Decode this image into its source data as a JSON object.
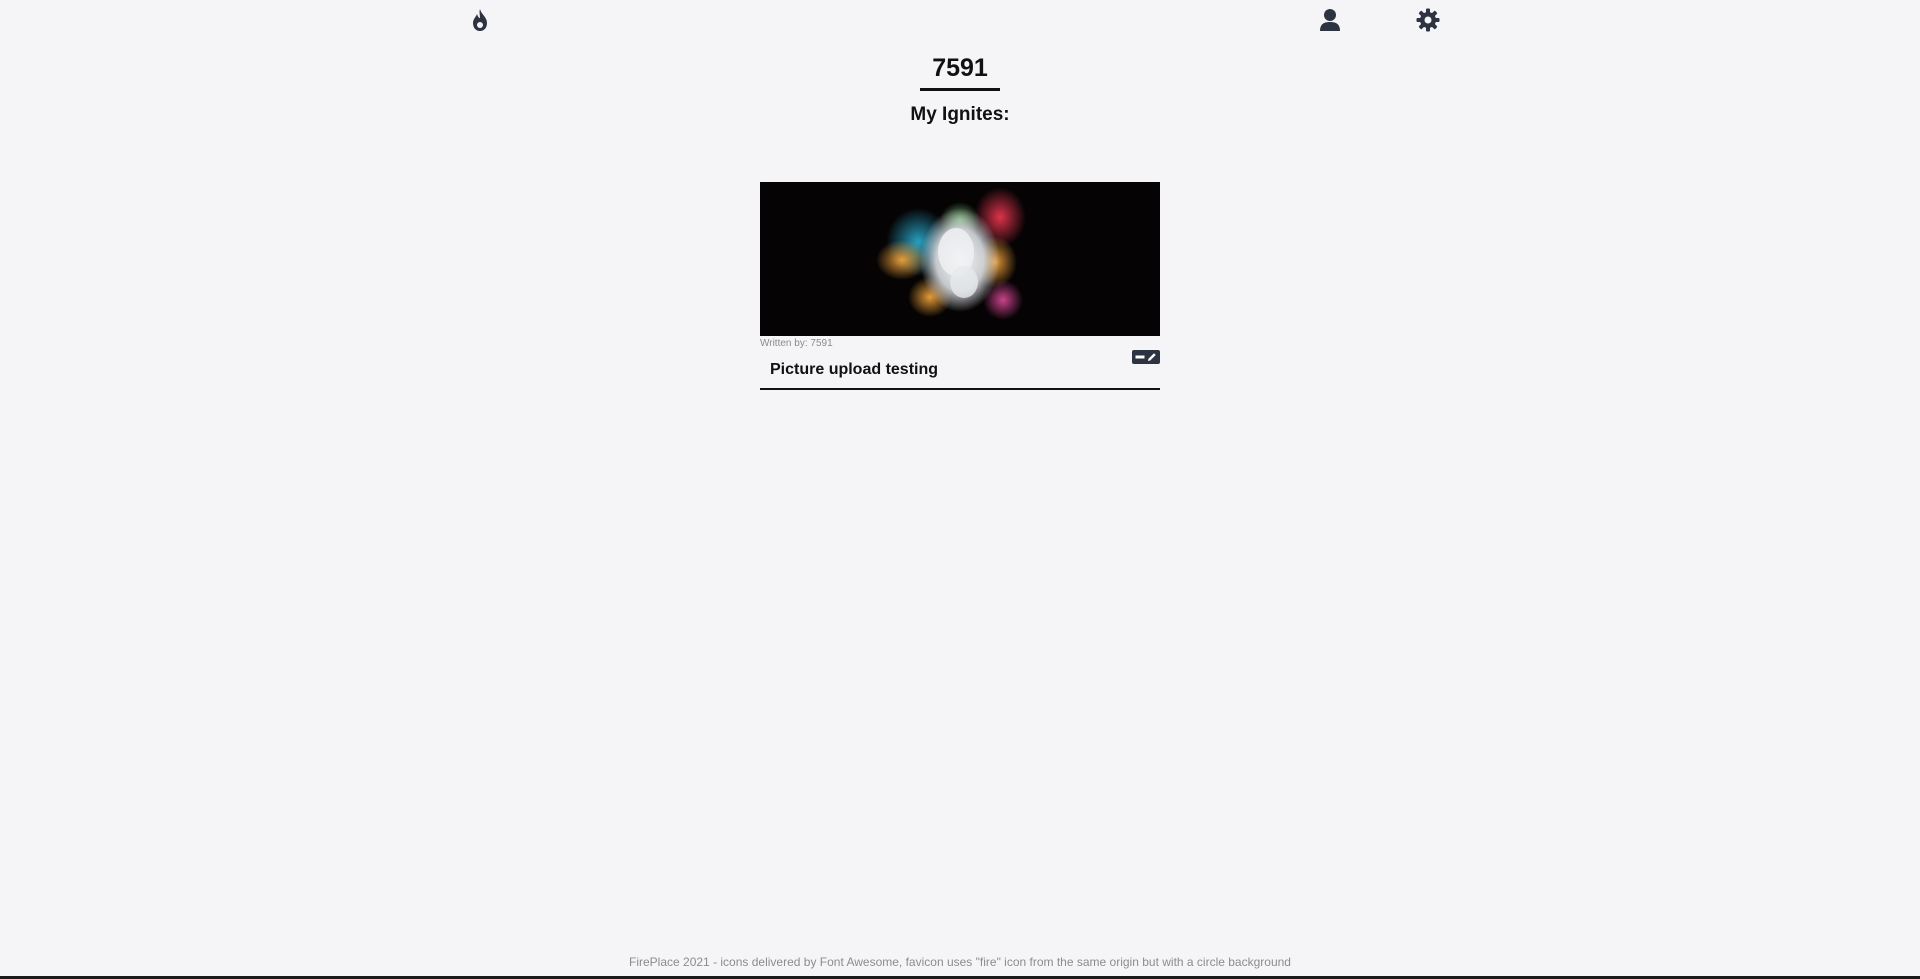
{
  "nav": {
    "home_icon": "fire-icon",
    "profile_icon": "user-icon",
    "settings_icon": "gear-icon"
  },
  "profile": {
    "username": "7591",
    "section_title": "My Ignites:"
  },
  "posts": [
    {
      "author_line": "Written by: 7591",
      "title": "Picture upload testing",
      "image": "colorful paint explosion on black background",
      "actions": [
        "minus-icon",
        "pencil-icon"
      ]
    }
  ],
  "footer": {
    "text": "FirePlace 2021 - icons delivered by Font Awesome, favicon uses \"fire\" icon from the same origin but with a circle background"
  },
  "colors": {
    "background": "#f5f5f7",
    "icon": "#2d3340",
    "text": "#111111",
    "muted": "#8c8c8c"
  }
}
